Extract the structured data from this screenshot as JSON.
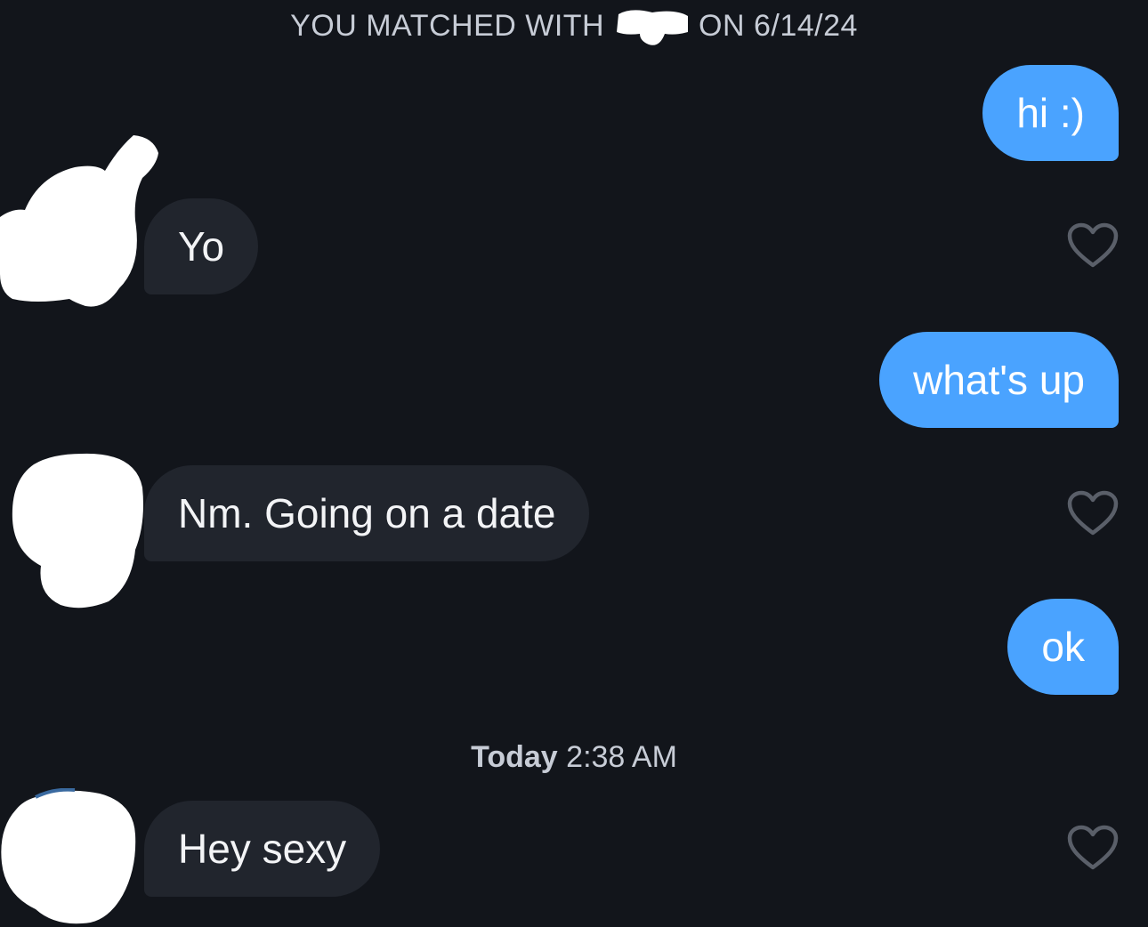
{
  "match": {
    "prefix": "YOU MATCHED WITH",
    "suffix": "ON 6/14/24"
  },
  "messages": [
    {
      "from": "me",
      "text": "hi :)"
    },
    {
      "from": "them",
      "text": "Yo"
    },
    {
      "from": "me",
      "text": "what's up"
    },
    {
      "from": "them",
      "text": "Nm. Going on a date"
    },
    {
      "from": "me",
      "text": "ok"
    },
    {
      "from": "them",
      "text": "Hey sexy"
    }
  ],
  "timestamp": {
    "day": "Today",
    "time": "2:38 AM"
  },
  "icons": {
    "like": "heart-outline-icon"
  },
  "colors": {
    "background": "#12151b",
    "sent_bubble": "#4aa3ff",
    "received_bubble": "#21252d",
    "meta_text": "#c7ccd6",
    "heart_outline": "#5a5f69"
  }
}
